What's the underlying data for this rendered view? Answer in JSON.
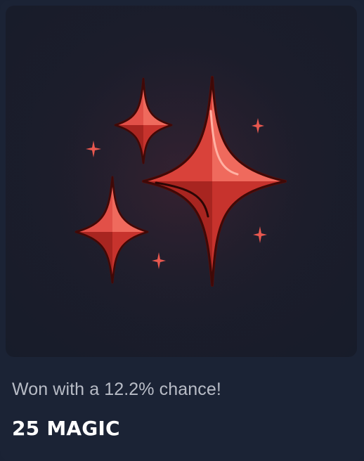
{
  "card": {
    "image_alt": "red sparkle stars",
    "image_icon": "sparkles-icon",
    "chance_text": "Won with a 12.2% chance!",
    "reward_text": "25 MAGIC"
  },
  "colors": {
    "background": "#1b2335",
    "image_background": "#1c1d2b",
    "star_fill": "#d9453d",
    "star_highlight": "#f0705f",
    "star_outline": "#7a1512",
    "chance_text": "#b8bcc6",
    "reward_text": "#ffffff"
  }
}
